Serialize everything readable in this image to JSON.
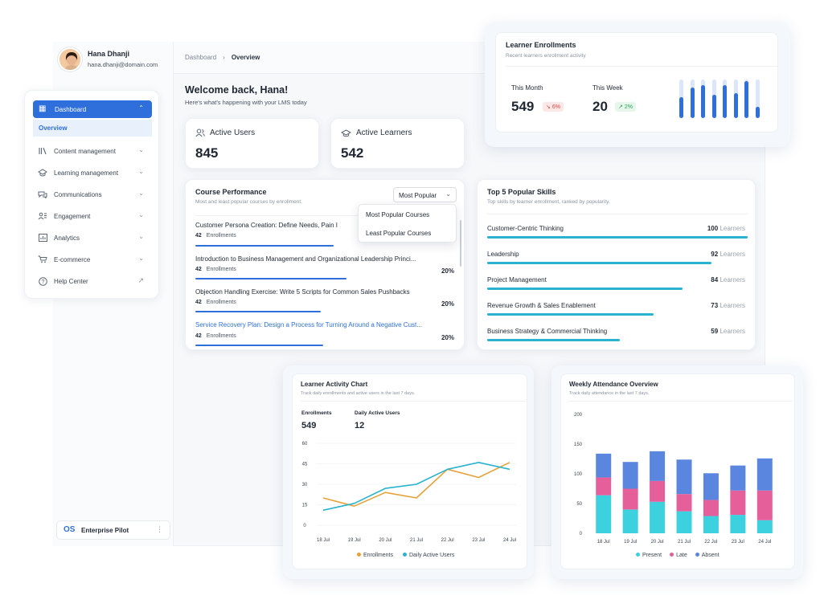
{
  "user": {
    "name": "Hana Dhanji",
    "email": "hana.dhanji@domain.com"
  },
  "breadcrumb": {
    "root": "Dashboard",
    "current": "Overview"
  },
  "welcome": {
    "title": "Welcome back, Hana!",
    "subtitle": "Here's what's happening with your LMS today"
  },
  "sidebar": {
    "items": [
      {
        "label": "Dashboard",
        "icon": "dashboard-icon",
        "active": true
      },
      {
        "label": "Overview",
        "sub": true
      },
      {
        "label": "Content management",
        "icon": "books-icon"
      },
      {
        "label": "Learning management",
        "icon": "graduation-cap-icon"
      },
      {
        "label": "Communications",
        "icon": "chat-icon"
      },
      {
        "label": "Engagement",
        "icon": "engagement-icon"
      },
      {
        "label": "Analytics",
        "icon": "analytics-icon"
      },
      {
        "label": "E-commerce",
        "icon": "cart-icon"
      },
      {
        "label": "Help Center",
        "icon": "help-icon"
      }
    ],
    "footer_org": "Enterprise Pilot",
    "footer_logo": "OS"
  },
  "stats": {
    "active_users": {
      "label": "Active Users",
      "value": "845"
    },
    "active_learners": {
      "label": "Active Learners",
      "value": "542"
    }
  },
  "course_performance": {
    "title": "Course Performance",
    "subtitle": "Most and least popular courses by enrollment.",
    "dropdown_value": "Most Popular",
    "dropdown_options": [
      "Most Popular Courses",
      "Least Popular Courses"
    ],
    "courses": [
      {
        "title": "Customer Persona Creation: Define Needs, Pain I",
        "count": "42",
        "unit": "Enrollments",
        "pct": "",
        "fill": 0.53
      },
      {
        "title": "Introduction to Business Management and Organizational Leadership Princi...",
        "count": "42",
        "unit": "Enrollments",
        "pct": "20%",
        "fill": 0.58
      },
      {
        "title": "Objection Handling Exercise: Write 5 Scripts for Common Sales Pushbacks",
        "count": "42",
        "unit": "Enrollments",
        "pct": "20%",
        "fill": 0.48
      },
      {
        "title": "Service Recovery Plan: Design a Process for Turning Around a Negative Cust...",
        "count": "42",
        "unit": "Enrollments",
        "pct": "20%",
        "fill": 0.49
      }
    ]
  },
  "skills": {
    "title": "Top 5 Popular Skills",
    "subtitle": "Top skills by learner enrollment, ranked by popularity.",
    "unit": "Learners",
    "items": [
      {
        "name": "Customer-Centric Thinking",
        "value": "100",
        "fill": 1.0
      },
      {
        "name": "Leadership",
        "value": "92",
        "fill": 0.86
      },
      {
        "name": "Project Management",
        "value": "84",
        "fill": 0.75
      },
      {
        "name": "Revenue Growth & Sales Enablement",
        "value": "73",
        "fill": 0.64
      },
      {
        "name": "Business Strategy & Commercial Thinking",
        "value": "59",
        "fill": 0.51
      }
    ]
  },
  "enrollments": {
    "title": "Learner Enrollments",
    "subtitle": "Recent learners enrollment activity",
    "month_label": "This Month",
    "month_value": "549",
    "month_change": "6%",
    "week_label": "This Week",
    "week_value": "20",
    "week_change": "2%",
    "mini_bars": [
      0.55,
      0.8,
      0.85,
      0.6,
      0.85,
      0.65,
      0.95,
      0.3
    ]
  },
  "colors": {
    "accent": "#2f6fdb",
    "teal": "#2ab3cf",
    "orange": "#e6a23a",
    "present": "#3dd1e0",
    "late": "#e5609b",
    "absent": "#5b86e0"
  },
  "chart_data": [
    {
      "type": "line",
      "title": "Learner Activity Chart",
      "subtitle": "Track daily enrollments and active users in the last 7 days.",
      "kpis": [
        {
          "label": "Enrollments",
          "value": "549"
        },
        {
          "label": "Daily Active Users",
          "value": "12"
        }
      ],
      "x": [
        "18 Jul",
        "19 Jul",
        "20 Jul",
        "21 Jul",
        "22 Jul",
        "23 Jul",
        "24 Jul"
      ],
      "ylim": [
        0,
        60
      ],
      "yticks": [
        0,
        15,
        30,
        45,
        60
      ],
      "series": [
        {
          "name": "Enrollments",
          "color": "#e6a23a",
          "values": [
            20,
            14,
            24,
            20,
            41,
            35,
            46
          ]
        },
        {
          "name": "Daily Active Users",
          "color": "#2ab3cf",
          "values": [
            11,
            16,
            27,
            30,
            41,
            46,
            41
          ]
        }
      ],
      "legend": "bottom"
    },
    {
      "type": "bar",
      "stacked": true,
      "title": "Weekly Attendance Overview",
      "subtitle": "Track daily attendance in the last 7 days.",
      "categories": [
        "18 Jul",
        "19 Jul",
        "20 Jul",
        "21 Jul",
        "22 Jul",
        "23 Jul",
        "24 Jul"
      ],
      "ylim": [
        0,
        200
      ],
      "yticks": [
        0,
        50,
        100,
        150,
        200
      ],
      "series": [
        {
          "name": "Present",
          "color": "#3dd1e0",
          "values": [
            64,
            40,
            53,
            37,
            29,
            31,
            22
          ]
        },
        {
          "name": "Late",
          "color": "#e5609b",
          "values": [
            30,
            35,
            35,
            29,
            27,
            41,
            50
          ]
        },
        {
          "name": "Absent",
          "color": "#5b86e0",
          "values": [
            40,
            45,
            50,
            58,
            45,
            42,
            54
          ]
        }
      ],
      "legend": "bottom"
    }
  ]
}
